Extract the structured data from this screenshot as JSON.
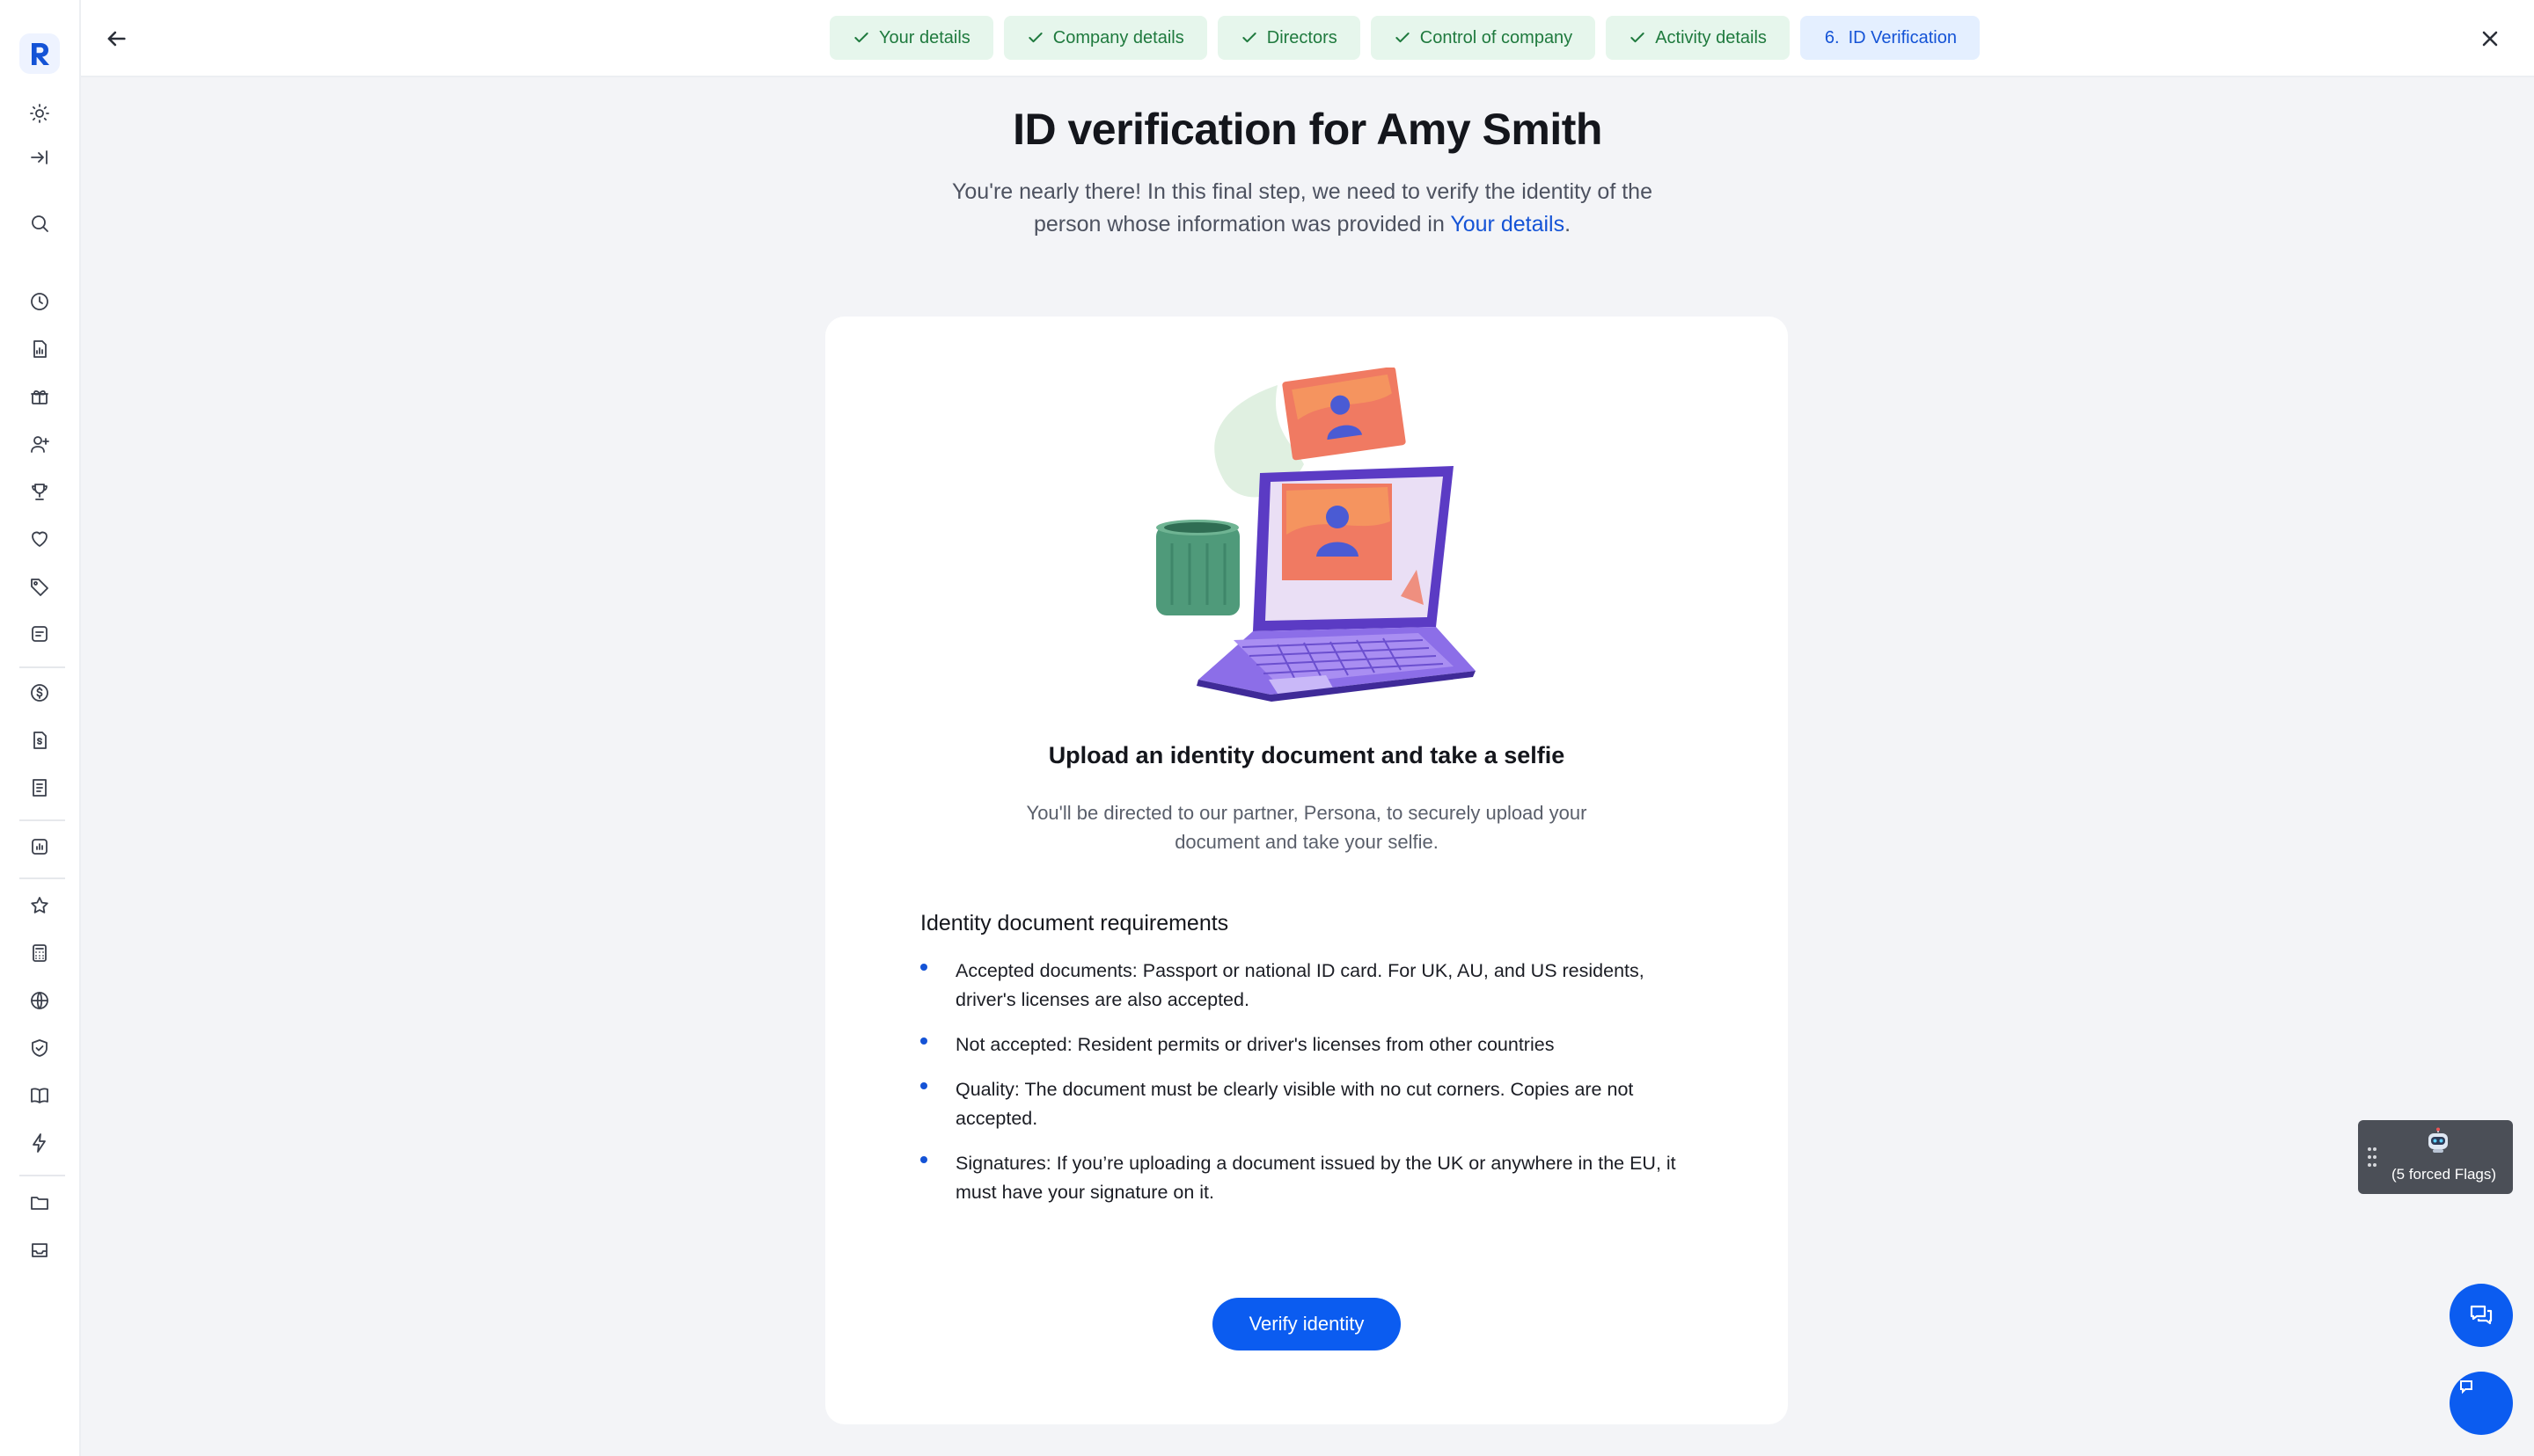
{
  "sidebar": {
    "logo": "R",
    "icons": [
      "sun-icon",
      "collapse-sidebar-icon",
      "search-icon",
      "clock-icon",
      "document-chart-icon",
      "gift-icon",
      "user-plus-icon",
      "trophy-icon",
      "heart-icon",
      "tag-icon",
      "notes-icon",
      "dollar-circle-icon",
      "file-dollar-icon",
      "receipt-icon",
      "chart-box-icon",
      "star-icon",
      "calculator-icon",
      "globe-icon",
      "shield-check-icon",
      "book-icon",
      "lightning-icon",
      "folder-icon",
      "inbox-icon"
    ]
  },
  "topbar": {
    "steps": [
      {
        "label": "Your details",
        "status": "complete"
      },
      {
        "label": "Company details",
        "status": "complete"
      },
      {
        "label": "Directors",
        "status": "complete"
      },
      {
        "label": "Control of company",
        "status": "complete"
      },
      {
        "label": "Activity details",
        "status": "complete"
      },
      {
        "number": "6.",
        "label": "ID Verification",
        "status": "active"
      }
    ]
  },
  "header": {
    "title": "ID verification for Amy Smith",
    "subtitle_before": "You're nearly there! In this final step, we need to verify the identity of the person whose information was provided in ",
    "subtitle_link": "Your details",
    "subtitle_after": "."
  },
  "card": {
    "title": "Upload an identity document and take a selfie",
    "description": "You'll be directed to our partner, Persona, to securely upload your document and take your selfie.",
    "requirements_title": "Identity document requirements",
    "requirements": [
      "Accepted documents: Passport or national ID card. For UK, AU, and US residents, driver's licenses are also accepted.",
      "Not accepted: Resident permits or driver's licenses from other countries",
      "Quality: The document must be clearly visible with no cut corners. Copies are not accepted.",
      "Signatures: If you’re uploading a document issued by the UK or anywhere in the EU, it must have your signature on it."
    ],
    "button_label": "Verify identity"
  },
  "flags_widget": {
    "text": "(5 forced Flags)"
  },
  "colors": {
    "accent": "#0b5cf0",
    "link": "#1453d6",
    "step_complete_bg": "#e6f6ec",
    "step_complete_text": "#1f7a3e",
    "step_active_bg": "#e4efff",
    "page_bg": "#f3f4f7"
  }
}
